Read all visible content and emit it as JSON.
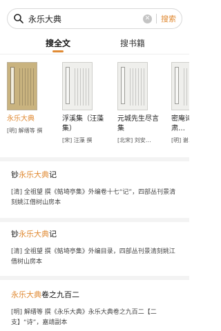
{
  "search": {
    "query": "永乐大典",
    "button_label": "搜索"
  },
  "tabs": [
    {
      "label": "搜全文",
      "active": true
    },
    {
      "label": "搜书籍",
      "active": false
    }
  ],
  "books": [
    {
      "title": "永乐大典",
      "meta": "[明] 解缙等 撰"
    },
    {
      "title": "浮溪集（汪藻集）",
      "meta": "[宋] 汪藻 撰"
    },
    {
      "title": "元城先生尽言集",
      "meta": "[北宋] 刘安…"
    },
    {
      "title": "密庵诗稿（谢肃…",
      "meta": "[明] 谢…"
    }
  ],
  "results": [
    {
      "title_pre": "钞",
      "title_hl": "永乐大典",
      "title_post": "记",
      "desc": "[清] 全祖望 撰《鲒埼亭集》外编卷十七“记”，四部丛刊景清刻姚江借树山房本"
    },
    {
      "title_pre": "钞",
      "title_hl": "永乐大典",
      "title_post": "记",
      "desc": "[清] 全祖望 撰《鲒埼亭集》外编目录，四部丛刊景清刻姚江借树山房本"
    },
    {
      "title_pre": "",
      "title_hl": "永乐大典",
      "title_post": "卷之九百二",
      "desc": "[明] 解缙等 撰《永乐大典》永乐大典卷之九百二【二支】“诗”，嘉靖副本"
    }
  ],
  "colors": {
    "accent": "#e08a33"
  }
}
